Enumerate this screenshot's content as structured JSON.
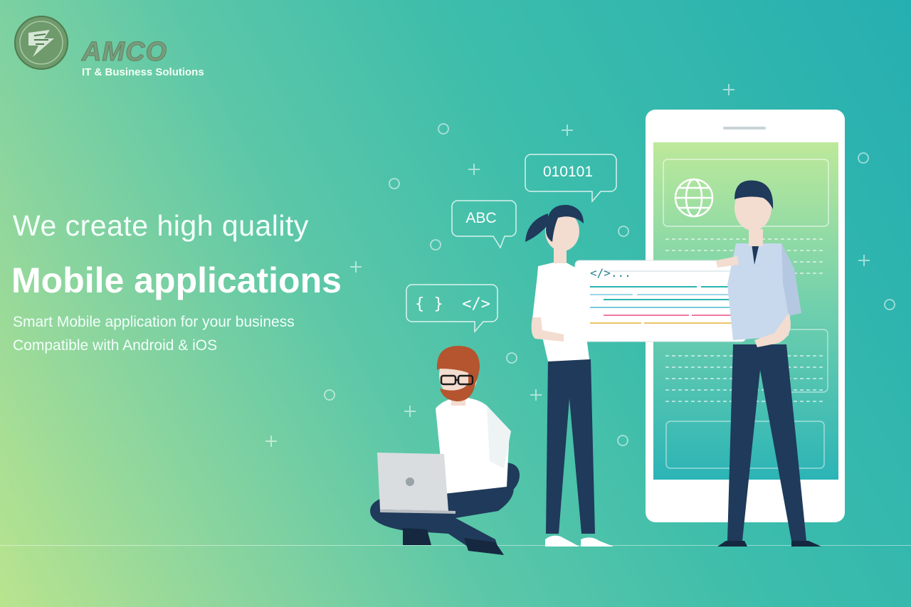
{
  "brand": {
    "name": "AMCO",
    "tagline": "IT & Business Solutions"
  },
  "hero": {
    "headline": "We create high quality",
    "title": "Mobile applications",
    "tagline_1": "Smart Mobile application for your business",
    "tagline_2": "Compatible with Android & iOS"
  },
  "illustration": {
    "bubble_binary": "010101",
    "bubble_abc": "ABC",
    "bubble_code": "{ }  </>",
    "card_code": "</>..."
  },
  "colors": {
    "gradient_start": "#b9e48e",
    "gradient_end": "#26afb1",
    "phone_screen_top": "#bde99a",
    "phone_screen_bottom": "#2cb4b6",
    "navy": "#1f3a5a",
    "skin": "#f3dcd0"
  },
  "icons": [
    "globe-icon",
    "plus-sparkle-icon",
    "circle-sparkle-icon"
  ]
}
